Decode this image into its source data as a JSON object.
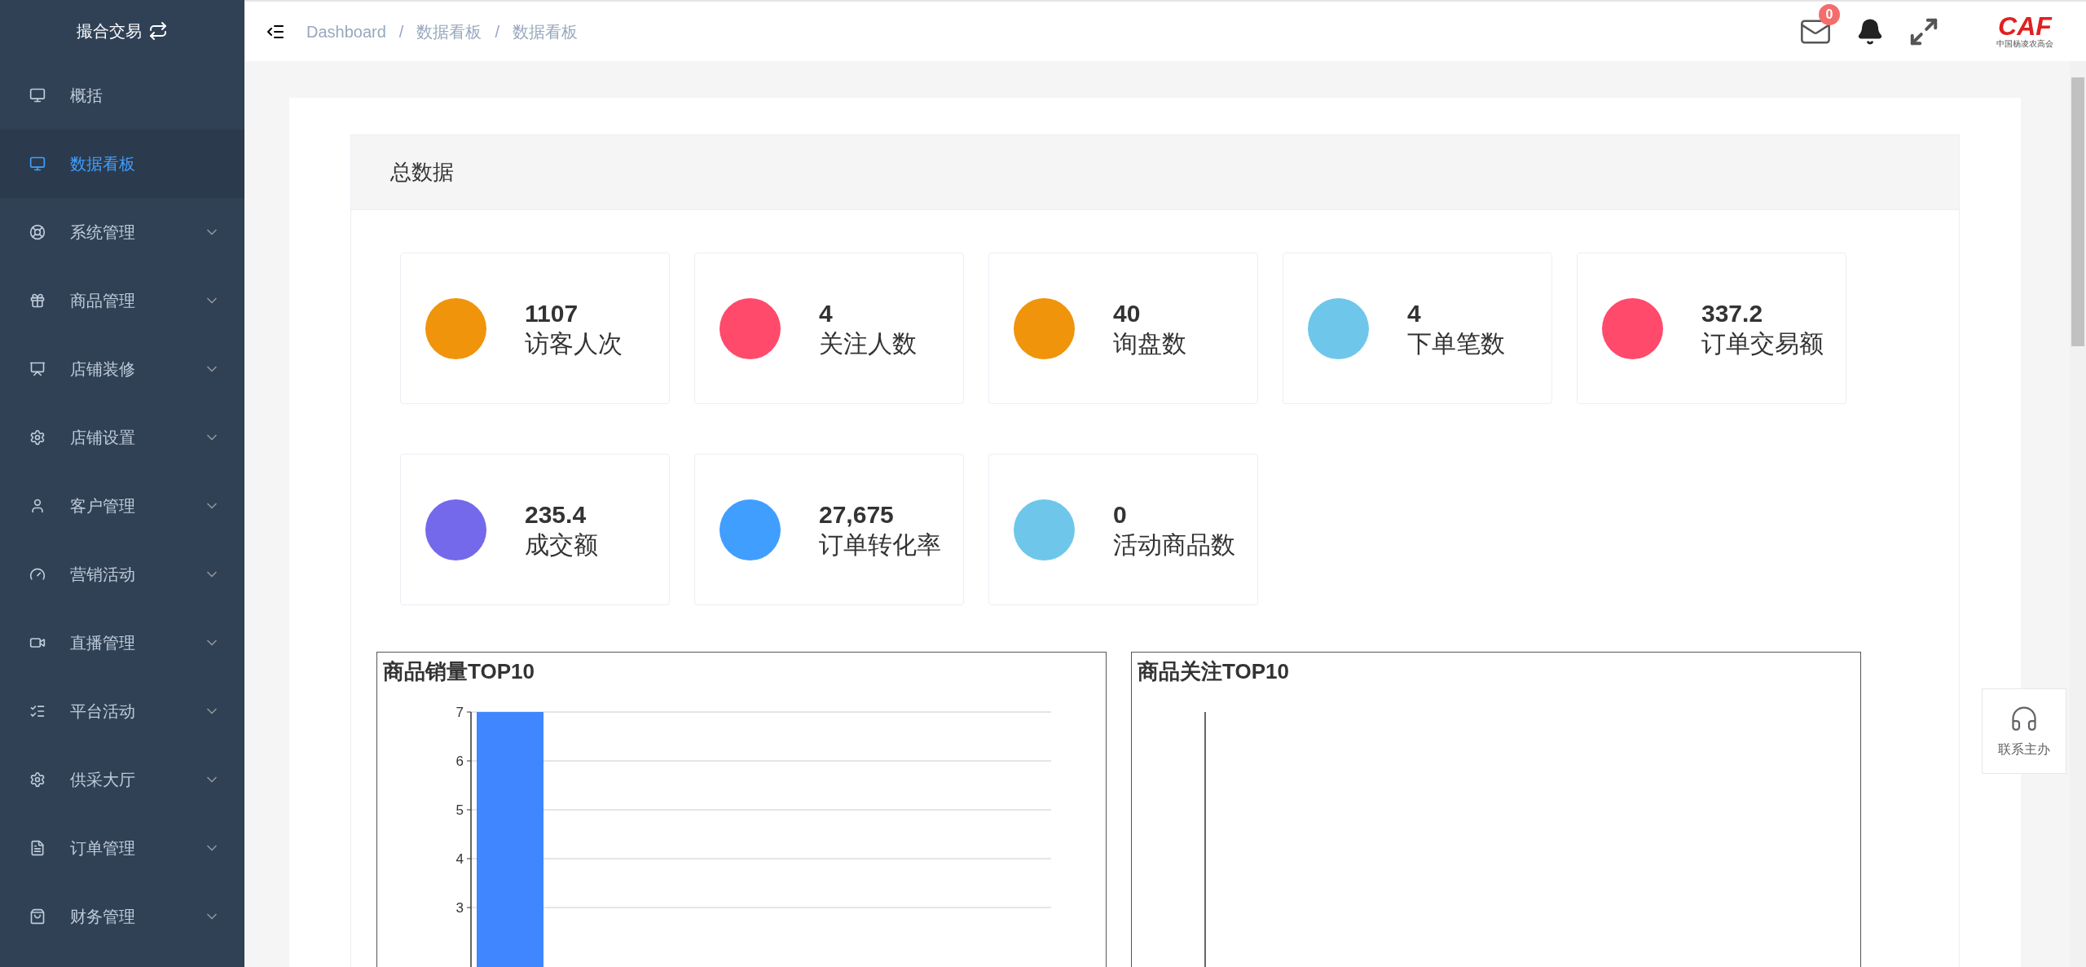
{
  "sidebar": {
    "title": "撮合交易",
    "items": [
      {
        "label": "概括",
        "selected": false,
        "expandable": false
      },
      {
        "label": "数据看板",
        "selected": true,
        "expandable": false
      },
      {
        "label": "系统管理",
        "selected": false,
        "expandable": true
      },
      {
        "label": "商品管理",
        "selected": false,
        "expandable": true
      },
      {
        "label": "店铺装修",
        "selected": false,
        "expandable": true
      },
      {
        "label": "店铺设置",
        "selected": false,
        "expandable": true
      },
      {
        "label": "客户管理",
        "selected": false,
        "expandable": true
      },
      {
        "label": "营销活动",
        "selected": false,
        "expandable": true
      },
      {
        "label": "直播管理",
        "selected": false,
        "expandable": true
      },
      {
        "label": "平台活动",
        "selected": false,
        "expandable": true
      },
      {
        "label": "供采大厅",
        "selected": false,
        "expandable": true
      },
      {
        "label": "订单管理",
        "selected": false,
        "expandable": true
      },
      {
        "label": "财务管理",
        "selected": false,
        "expandable": true
      }
    ]
  },
  "breadcrumb": {
    "items": [
      "Dashboard",
      "数据看板",
      "数据看板"
    ],
    "separator": "/"
  },
  "header": {
    "mail_badge": "0",
    "logo": "CAF",
    "logo_subtitle": "中国杨凌农高会"
  },
  "panel": {
    "title": "总数据",
    "stats": [
      {
        "value": "1107",
        "label": "访客人次",
        "color": "#f0940b"
      },
      {
        "value": "4",
        "label": "关注人数",
        "color": "#ff4a6b"
      },
      {
        "value": "40",
        "label": "询盘数",
        "color": "#f0940b"
      },
      {
        "value": "4",
        "label": "下单笔数",
        "color": "#6ec7ea"
      },
      {
        "value": "337.2",
        "label": "订单交易额",
        "color": "#ff4a6b"
      },
      {
        "value": "235.4",
        "label": "成交额",
        "color": "#7469ea"
      },
      {
        "value": "27,675",
        "label": "订单转化率",
        "color": "#409eff"
      },
      {
        "value": "0",
        "label": "活动商品数",
        "color": "#6ec7ea"
      }
    ]
  },
  "charts": [
    {
      "title": "商品销量TOP10",
      "chart_data": {
        "type": "bar",
        "series": [
          {
            "color": "#3f86ff",
            "values": [
              7
            ]
          }
        ],
        "yticks": [
          3,
          4,
          5,
          6,
          7
        ],
        "ylim": [
          1.5,
          7
        ],
        "grid": true
      }
    },
    {
      "title": "商品关注TOP10"
    }
  ],
  "contact": {
    "label": "联系主办"
  }
}
